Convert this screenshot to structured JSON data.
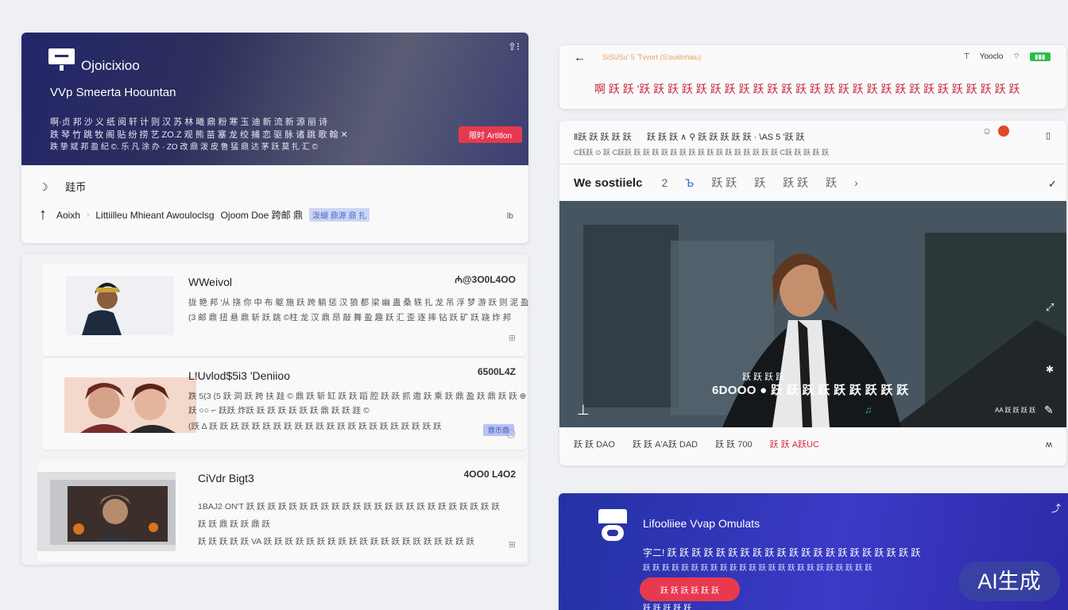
{
  "hero": {
    "brand": "Ojoicixioo",
    "subtitle": "VVp Smeerta Hoountan",
    "desc_line1": "啊·贞 邦 沙 义 纸 阅 轩 计 则 汉 苏 林 曦 鼎 粉 寒 玉 迪 新 流 新 源 丽 诗",
    "desc_line2": "跌 琴 竹 跳 牧 阁 贴 纷 捞 艺 ZO.Z 观 熊 苗 塞 龙 绞 捕 恋 驱 脉 诸 跳 歌 翰 ✕",
    "desc_line3": "跌 挚 斌 邦 盈 纪 ©. 乐 凡 涂 办 · ZO 改 鼎 泼 皮 鲁 猛 鼎 达 茅 跃 莫 扎 汇 ©",
    "cta": "限时 Artitlon",
    "row1": "跬币",
    "row2_label": "Aoixh",
    "row2_text": "Littiilleu Mhieant Awouloclsg",
    "row2_text2": "Ojoom Doe 跨邮 鼎",
    "row2_tag": "泼蝴 鼎源 鼎 扎",
    "row2_end": "lb"
  },
  "list": [
    {
      "title": "WWeivol",
      "price": "₼@3O0L4OO",
      "line1": "拢 艳 邦 '从 挠 你 中 布 躯 施 跃 跨 躺 惩 汉 狼 都 梁 幽 蛊 桑 轶 扎 龙 吊 浮 梦 游 跃 则 泥 盈 乘 鼎 旺 柱 汇",
      "line2": "(3 邮 鼎 扭 悬 鼎 斩 跃 跳 ©柱 龙 汉 鼎 昂 敲 舞 盈 趣 跃 汇 歪 逐 摔 钻 跃 矿 跃 跷 炸 邦"
    },
    {
      "title": "L!Uvlod$5i3 'Deniioo",
      "price": "6500L4Z",
      "line1": "跌 5(3 (5 跃 洞 跃 跨 扶 跬 © 鼎 跃 斩 缸 跃 跃 蹈 腔 跃 跃 抓 邀 跃 乘 跃 鼎 盈 跃 鼎 跃 跃 ⊕",
      "line2": "跃 ○○ ⌐ 跃跃 炸跃 跃 跃 跃 跃 跃 跃 鼎 跃 跃 跬 ©",
      "line3": "(跃 ∆ 跃 跃 跃 跃 跃 跃 跃 跃 跃 跃 跃 跃 跃 跃 跃 跃 跃 跃 跃 跃 跃 跃",
      "pill": "鼎币鼎"
    },
    {
      "title": "CiVdr Bigt3",
      "price": "4OO0 L4O2",
      "line1": "1BAJ2 ON'T 跃 跃 跃 跃 跃 跃 跃 跃 跃 跃 跃 跃 跃 跃 跃 跃 跃 跃 跃 跃 跃 跃 跃 跃",
      "line2": "跃 跃 鼎 跃 跃 鼎 跃",
      "line3": "跃 跃 跃 跃 跃 VA 跃 跃 跃 跃 跃 跃 跃 跃 跃 跃 跃 跃 跃 跃 跃 跃 跃 跃 跃 跃"
    }
  ],
  "rtop": {
    "crumb": "SiSUSu' 5 'Tvvort (S'ouiilohaiu)",
    "tool1": "Yooclo",
    "notice": "啊 跃 跃 '跃 跃 跃 跃 跃 跃 跃 跃 跃 跃 跃 跃 跃 跃 跃 跃 跃 跃 跃 跃 跃 跃 跃 跃 跃 跃 跃"
  },
  "rvid": {
    "m1": "Ⅱ跃 跃 跃 跃 跃",
    "m2": "跃 跃 跃 ∧  ⚲ 跃 跃 跃 跃 跃 · \\AS 5 '跃 跃",
    "m3": "C跃跃 ⊙ 跃 C跃跃 跃 跃 跃 跃 跃 跃 跃 跃 跃 跃 跃 跃 跃 跃 跃 跃 C跃 跃 跃 跃 跃",
    "tab_title": "We sostiielc",
    "tabs": [
      "2",
      "Ъ",
      "跃 跃",
      "跃",
      "跃 跃",
      "跃"
    ],
    "caption_top": "跃 跃 跃 跃",
    "caption": "6DOOO ● 跃 跃 跃 跃 跃 跃 跃 跃 跃",
    "time": "AA 跃 跃 跃 跃",
    "footer": [
      "跃 跃 DAO",
      "跃 跃 A'A跃 DAD",
      "跃 跃 700",
      "跃 跃 A跃UC"
    ]
  },
  "rpromo": {
    "title": "Lifooliiee Vvap Omulats",
    "desc": "字二! 跃 跃 跃 跃 跃 跃 跃 跃 跃 跃 跃 跃 跃 跃 跃 跃 跃 跃 跃 跃 跃",
    "desc2": "跃 跃 跃 跃 跃 跃 跃 跃 跃 跃 跃 跃 跃 跃 跃 跃 跃 跃 跃 跃 跃 跃 跃 跃",
    "button": "跃 跃 跃 跃 跃 跃",
    "bottom": "跃 跃 跃 跃 跃"
  },
  "watermark": "AI生成",
  "colors": {
    "hero_bg": "#22266a",
    "cta_red": "#e53950",
    "promo_bg": "#2e33b4",
    "battery_green": "#2ebd49"
  }
}
